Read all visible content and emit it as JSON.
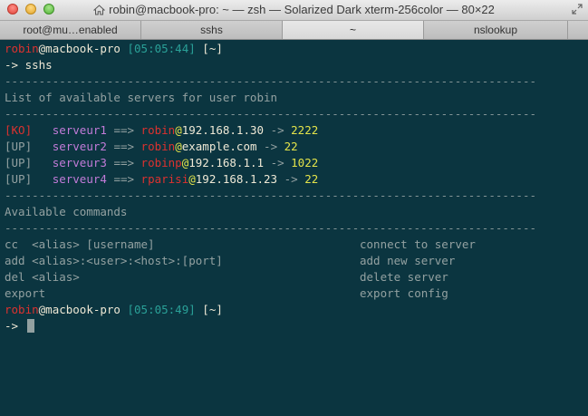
{
  "window": {
    "title": "robin@macbook-pro: ~ — zsh — Solarized Dark xterm-256color — 80×22"
  },
  "tabs": [
    {
      "label": "root@mu…enabled"
    },
    {
      "label": "sshs"
    },
    {
      "label": "~"
    },
    {
      "label": "nslookup"
    }
  ],
  "terminal": {
    "prompt1": {
      "user": "robin",
      "at": "@",
      "host": "macbook-pro",
      "time": "[05:05:44]",
      "dir": "[~]"
    },
    "command1": {
      "arrow": "->",
      "text": "sshs"
    },
    "separator": "------------------------------------------------------------------------------",
    "section1_title": "List of available servers for user robin",
    "servers": [
      {
        "status": "[KO]",
        "status_color": "#dc322f",
        "alias": "serveur1",
        "arrow": "==>",
        "user": "robin",
        "at": "@",
        "host": "192.168.1.30",
        "sep": "->",
        "port": "2222"
      },
      {
        "status": "[UP]",
        "status_color": "#93a1a1",
        "alias": "serveur2",
        "arrow": "==>",
        "user": "robin",
        "at": "@",
        "host": "example.com",
        "sep": "->",
        "port": "22"
      },
      {
        "status": "[UP]",
        "status_color": "#93a1a1",
        "alias": "serveur3",
        "arrow": "==>",
        "user": "robinp",
        "at": "@",
        "host": "192.168.1.1",
        "sep": "->",
        "port": "1022"
      },
      {
        "status": "[UP]",
        "status_color": "#93a1a1",
        "alias": "serveur4",
        "arrow": "==>",
        "user": "rparisi",
        "at": "@",
        "host": "192.168.1.23",
        "sep": "->",
        "port": "22"
      }
    ],
    "section2_title": "Available commands",
    "commands": [
      {
        "syntax": "cc  <alias> [username]",
        "description": "connect to server"
      },
      {
        "syntax": "add <alias>:<user>:<host>:[port]",
        "description": "add new server"
      },
      {
        "syntax": "del <alias>",
        "description": "delete server"
      },
      {
        "syntax": "export",
        "description": "export config"
      }
    ],
    "prompt2": {
      "user": "robin",
      "at": "@",
      "host": "macbook-pro",
      "time": "[05:05:49]",
      "dir": "[~]"
    },
    "command2": {
      "arrow": "->",
      "text": ""
    }
  },
  "colors": {
    "background": "#0b3540",
    "foreground": "#93a1a1",
    "red": "#dc322f",
    "cyan": "#2aa198",
    "violet": "#c27bd8",
    "yellow": "#e3e34a"
  },
  "icons": {
    "title_home": "home-icon",
    "fullscreen": "fullscreen-icon"
  }
}
